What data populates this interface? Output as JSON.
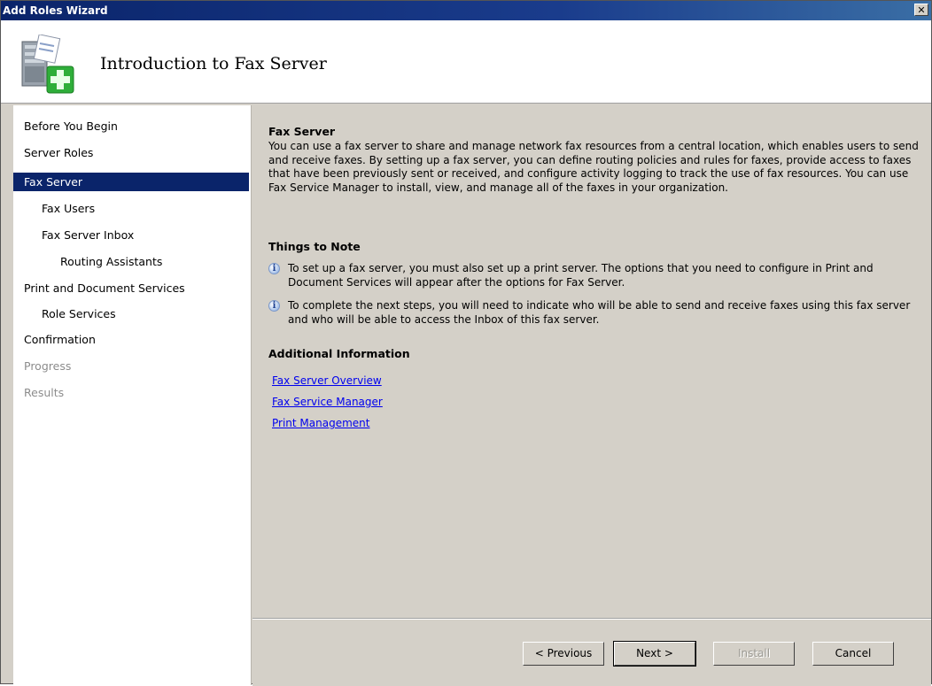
{
  "window": {
    "title": "Add Roles Wizard",
    "close_glyph": "✕"
  },
  "header": {
    "icon": "server-add-icon",
    "title": "Introduction to Fax Server"
  },
  "sidebar": {
    "items": [
      {
        "label": "Before You Begin",
        "state": "normal"
      },
      {
        "label": "Server Roles",
        "state": "normal"
      },
      {
        "label": "Fax Server",
        "state": "selected"
      },
      {
        "label": "Fax Users",
        "state": "normal"
      },
      {
        "label": "Fax Server Inbox",
        "state": "normal"
      },
      {
        "label": "Routing Assistants",
        "state": "normal"
      },
      {
        "label": "Print and Document Services",
        "state": "normal"
      },
      {
        "label": "Role Services",
        "state": "normal"
      },
      {
        "label": "Confirmation",
        "state": "normal"
      },
      {
        "label": "Progress",
        "state": "disabled"
      },
      {
        "label": "Results",
        "state": "disabled"
      }
    ]
  },
  "content": {
    "section_title": "Fax Server",
    "intro": "You can use a fax server to share and manage network fax resources from a central location, which enables users to send and receive faxes. By setting up a fax server, you can define routing policies and rules for faxes, provide access to faxes that have been previously sent or received, and configure activity logging to track the use of fax resources. You can use Fax Service Manager to install, view, and manage all of the faxes in your organization.",
    "notes_title": "Things to Note",
    "notes": [
      "To set up a fax server, you must also set up a print server. The options that you need to configure in Print and Document Services will appear after the options for Fax Server.",
      "To complete the next steps, you will need to indicate who will be able to send and receive faxes using this fax server and who will be able to access the Inbox of this fax server."
    ],
    "additional_title": "Additional Information",
    "links": [
      "Fax Server Overview",
      "Fax Service Manager",
      "Print Management"
    ]
  },
  "footer": {
    "previous_label": "< Previous",
    "next_label": "Next >",
    "install_label": "Install",
    "cancel_label": "Cancel"
  }
}
